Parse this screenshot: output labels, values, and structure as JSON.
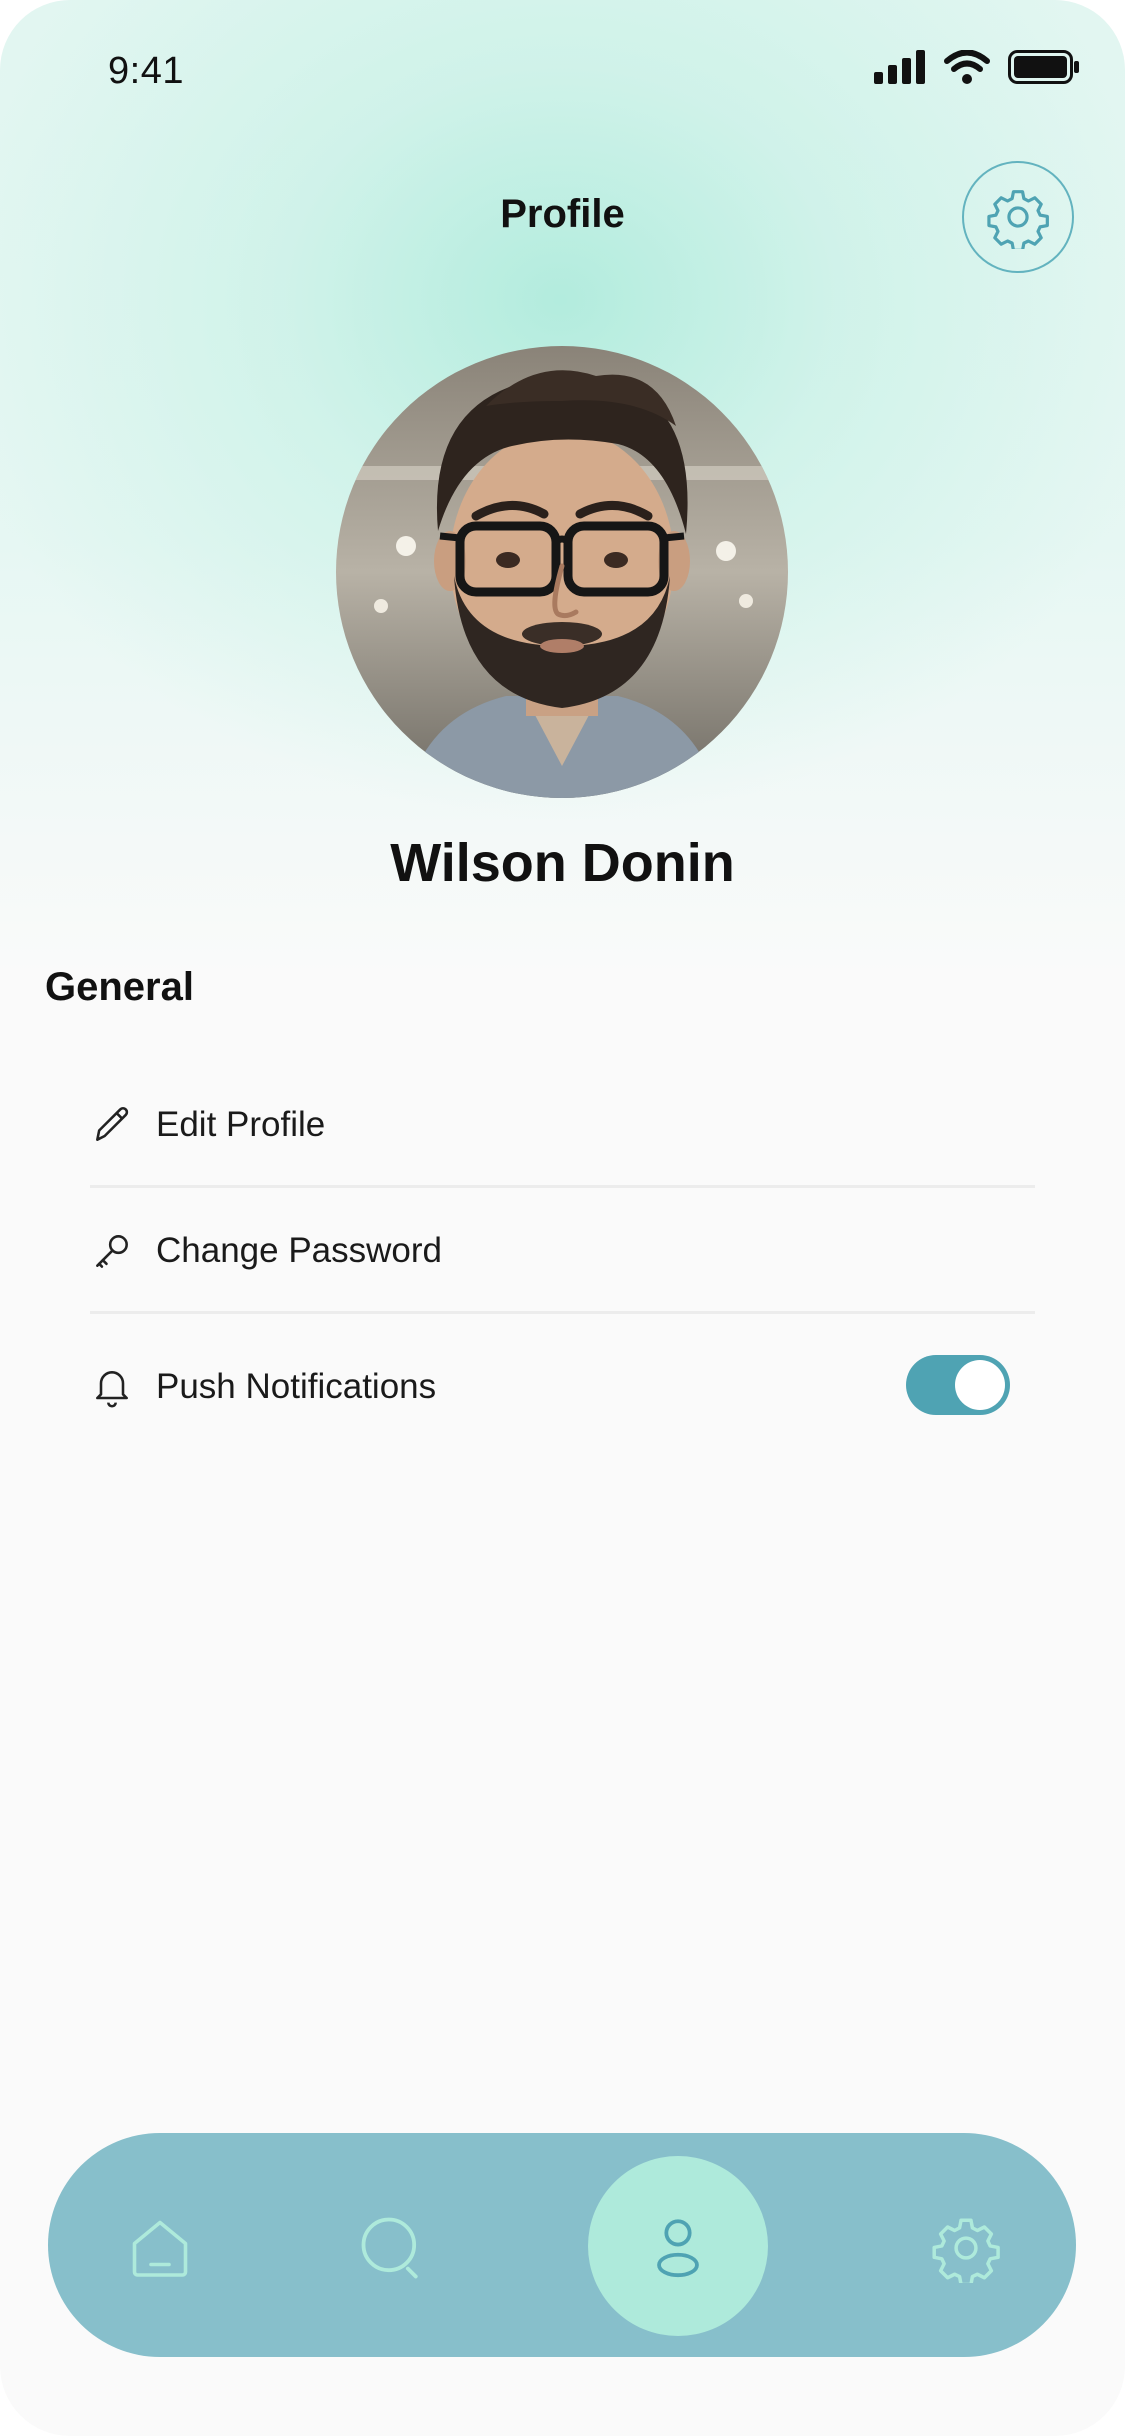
{
  "status_bar": {
    "time": "9:41"
  },
  "header": {
    "title": "Profile"
  },
  "profile": {
    "name": "Wilson Donin"
  },
  "general": {
    "title": "General",
    "items": [
      {
        "label": "Edit Profile",
        "icon": "pencil-icon"
      },
      {
        "label": "Change Password",
        "icon": "key-icon"
      },
      {
        "label": "Push Notifications",
        "icon": "bell-icon",
        "toggle_on": true
      }
    ]
  },
  "bottom_nav": {
    "items": [
      {
        "name": "home",
        "icon": "home-icon",
        "active": false
      },
      {
        "name": "search",
        "icon": "search-icon",
        "active": false
      },
      {
        "name": "profile",
        "icon": "user-icon",
        "active": true
      },
      {
        "name": "settings",
        "icon": "gear-icon",
        "active": false
      }
    ]
  },
  "colors": {
    "accent": "#4fa3b3",
    "nav_bar": "#87bfcb",
    "nav_active": "#aeeadb",
    "hero_tint": "#c8f0e5"
  }
}
